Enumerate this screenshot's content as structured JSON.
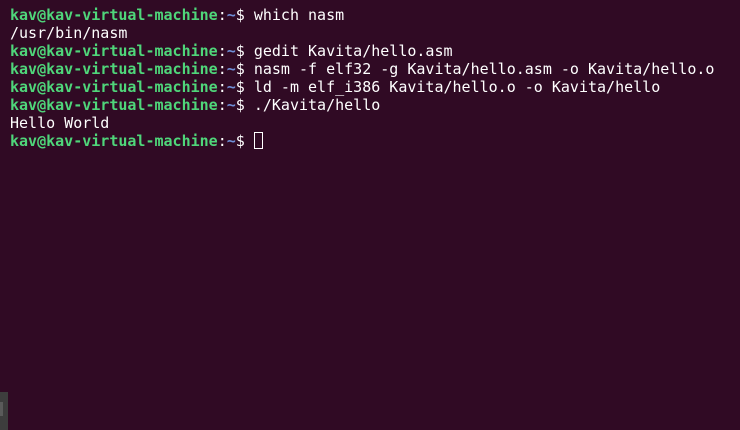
{
  "prompt": {
    "user_host": "kav@kav-virtual-machine",
    "colon": ":",
    "path": "~",
    "dollar": "$ "
  },
  "lines": [
    {
      "type": "prompt",
      "command": "which nasm"
    },
    {
      "type": "output",
      "text": "/usr/bin/nasm"
    },
    {
      "type": "prompt",
      "command": "gedit Kavita/hello.asm"
    },
    {
      "type": "prompt",
      "command": "nasm -f elf32 -g Kavita/hello.asm -o Kavita/hello.o"
    },
    {
      "type": "prompt",
      "command": "ld -m elf_i386 Kavita/hello.o -o Kavita/hello"
    },
    {
      "type": "prompt",
      "command": "./Kavita/hello"
    },
    {
      "type": "output",
      "text": "Hello World"
    },
    {
      "type": "prompt",
      "command": ""
    }
  ],
  "colors": {
    "background": "#300a24",
    "user_host": "#4fd67a",
    "path": "#6f8fd8",
    "text": "#ffffff"
  }
}
